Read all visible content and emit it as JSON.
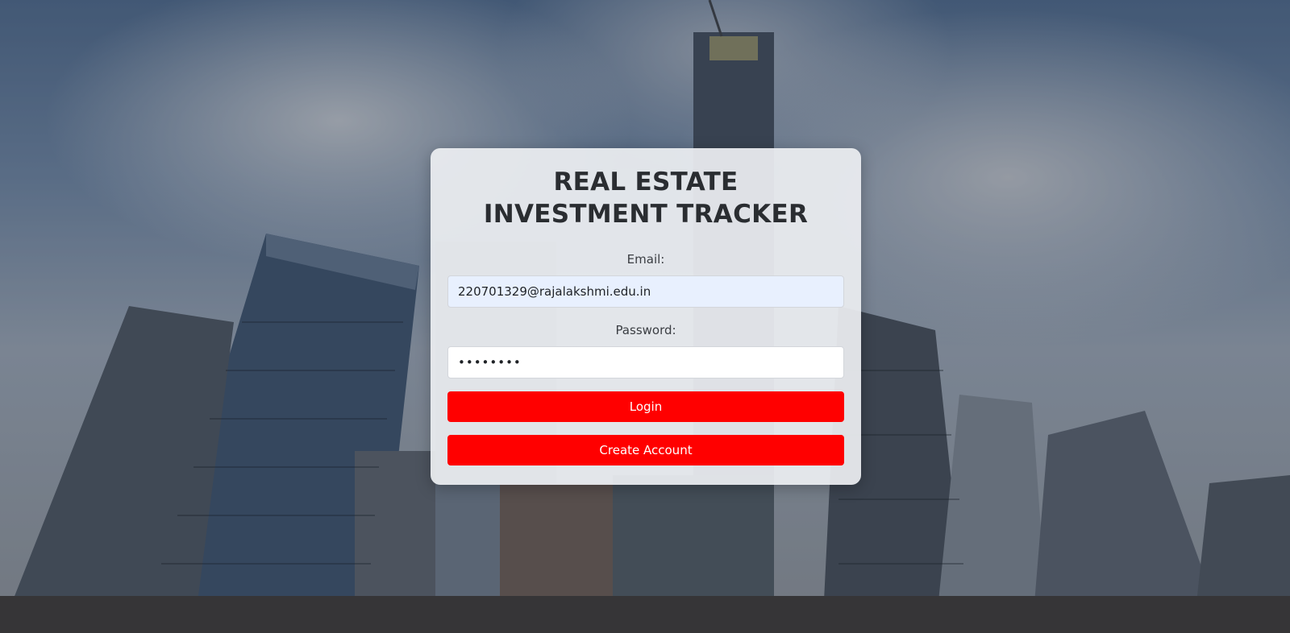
{
  "page": {
    "title": "REAL ESTATE INVESTMENT TRACKER"
  },
  "form": {
    "email_label": "Email:",
    "email_value": "220701329@rajalakshmi.edu.in",
    "password_label": "Password:",
    "password_value": "••••••••",
    "login_label": "Login",
    "create_account_label": "Create Account"
  },
  "colors": {
    "button": "#ff0000",
    "card": "#eceef1",
    "autofill_field": "#e8f0fe"
  },
  "background": {
    "image_description_icon": "city-skyline-background"
  }
}
